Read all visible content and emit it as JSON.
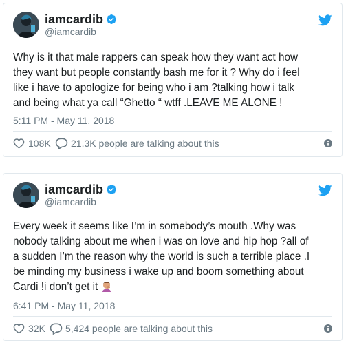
{
  "colors": {
    "twitter_blue": "#1da1f2",
    "text": "#1c2022",
    "muted": "#697882",
    "border": "#e1e8ed"
  },
  "tweets": [
    {
      "display_name": "iamcardib",
      "screen_name": "@iamcardib",
      "verified_icon": "verified-badge-icon",
      "text": "Why is it that male rappers can speak how they want act how\nthey want but people constantly bash me for it ? Why do i feel\nlike i have to apologize for being who i am ?talking how i talk\nand being what ya call “Ghetto “ wtff .LEAVE ME ALONE !",
      "emoji": "",
      "timestamp": "5:11 PM - May 11, 2018",
      "likes": "108K",
      "talking": "21.3K people are talking about this"
    },
    {
      "display_name": "iamcardib",
      "screen_name": "@iamcardib",
      "verified_icon": "verified-badge-icon",
      "text": "Every week it seems like I’m in somebody’s mouth .Why was\nnobody talking about me when i was on love and hip hop ?all of\na sudden I’m the reason why the world is such a terrible place .I\nbe minding my business i wake up and boom something about\nCardi !i don’t get it",
      "emoji": "facepalm-icon",
      "timestamp": "6:41 PM - May 11, 2018",
      "likes": "32K",
      "talking": "5,424 people are talking about this"
    }
  ]
}
